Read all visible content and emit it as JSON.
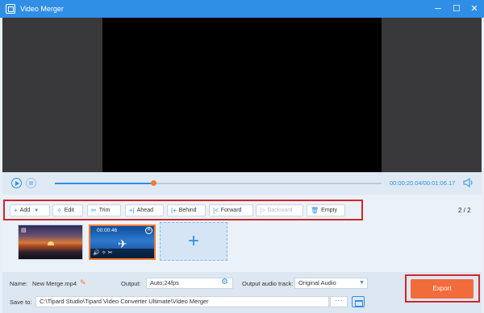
{
  "window": {
    "title": "Video Merger",
    "minimize": "─",
    "maximize": "☐",
    "close": "✕"
  },
  "playback": {
    "progress_fraction": 0.3,
    "current_time": "00:00:20.04",
    "total_time": "/00:01:06.17",
    "play_icon": "play-icon",
    "stop_icon": "stop-icon",
    "volume_icon": "volume-icon"
  },
  "toolbar": {
    "add": "Add",
    "edit": "Edit",
    "trim": "Trim",
    "ahead": "Ahead",
    "behind": "Behind",
    "forward": "Forward",
    "backward": "Backward",
    "empty": "Empty",
    "icons": {
      "add": "+",
      "edit": "✧",
      "trim": "✂",
      "ahead": "+|",
      "behind": "|+",
      "forward": "|<",
      "backward": "|>",
      "empty": "🗑"
    }
  },
  "clips": {
    "counter": "2 / 2",
    "clip2_time": "00:00:46",
    "clip2_tools": "🔊✧✂",
    "add_symbol": "+"
  },
  "bottom": {
    "name_label": "Name:",
    "name_value": "New Merge.mp4",
    "output_label": "Output:",
    "output_value": "Auto;24fps",
    "audio_label": "Output audio track:",
    "audio_value": "Original Audio",
    "save_label": "Save to:",
    "save_path": "C:\\Tipard Studio\\Tipard Video Converter Ultimate\\Video Merger",
    "dots": "···",
    "export": "Export"
  },
  "colors": {
    "accent": "#2f8ee6",
    "highlight": "#d2262c",
    "export": "#f26b3a"
  }
}
